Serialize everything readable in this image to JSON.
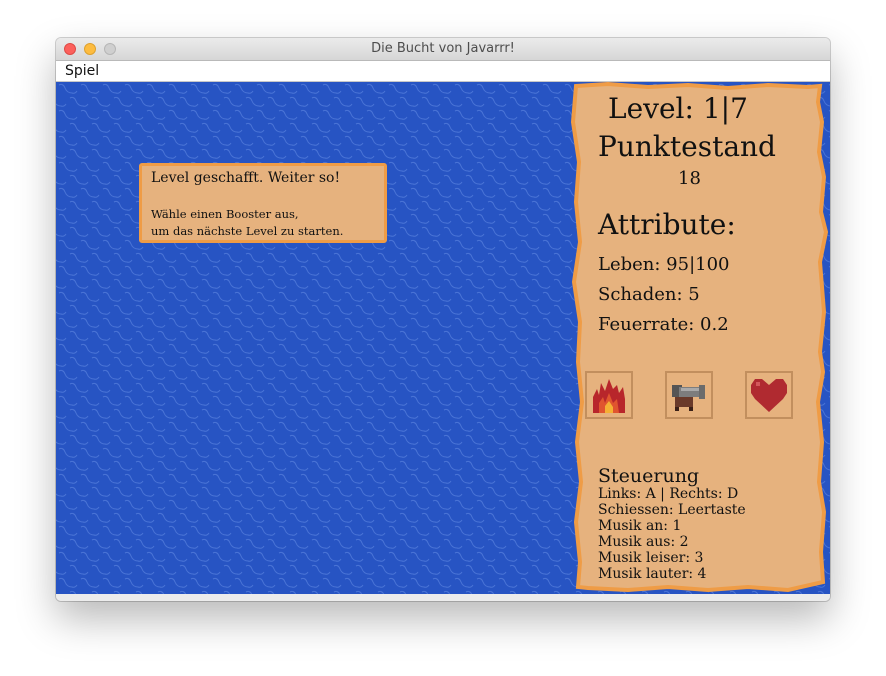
{
  "window": {
    "title": "Die Bucht von Javarrr!"
  },
  "menu": {
    "items": [
      "Spiel"
    ]
  },
  "popup": {
    "title": "Level geschafft. Weiter so!",
    "line1": "Wähle einen Booster aus,",
    "line2": "um das nächste Level zu starten."
  },
  "panel": {
    "level": "Level: 1|7",
    "score_label": "Punktestand",
    "score_value": "18",
    "attributes_title": "Attribute:",
    "attributes": {
      "life": "Leben: 95|100",
      "damage": "Schaden: 5",
      "fire_rate": "Feuerrate: 0.2"
    },
    "boosters": [
      {
        "icon": "fire-icon",
        "name": "fire"
      },
      {
        "icon": "cannon-icon",
        "name": "cannon"
      },
      {
        "icon": "heart-icon",
        "name": "heart"
      }
    ],
    "controls_title": "Steuerung",
    "controls": [
      "Links: A  |  Rechts: D",
      "Schiessen: Leertaste",
      "Musik an: 1",
      "Musik aus: 2",
      "Musik leiser: 3",
      "Musik lauter: 4"
    ]
  },
  "colors": {
    "water": "#2754c3",
    "parchment": "#e6b27e",
    "parchment_edge": "#ef9c46"
  }
}
